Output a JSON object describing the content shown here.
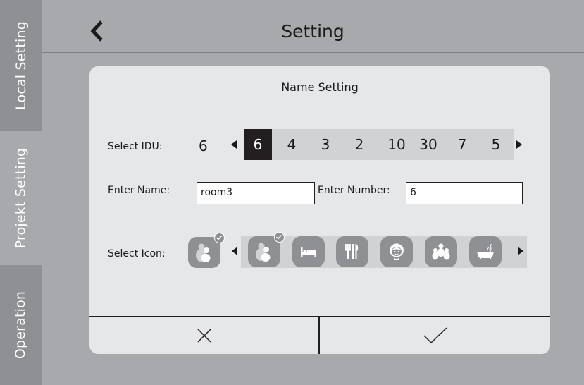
{
  "sidebar": {
    "tabs": [
      {
        "label": "Local Setting",
        "active": false
      },
      {
        "label": "Projekt Setting",
        "active": true
      },
      {
        "label": "Operation",
        "active": false
      }
    ]
  },
  "header": {
    "title": "Setting",
    "back_icon": "chevron-left-icon"
  },
  "dialog": {
    "title": "Name Setting",
    "select_idu": {
      "label": "Select IDU:",
      "current": "6",
      "options": [
        "6",
        "4",
        "3",
        "2",
        "10",
        "30",
        "7",
        "5"
      ],
      "selected_index": 0
    },
    "enter_name": {
      "label": "Enter Name:",
      "value": "room3"
    },
    "enter_number": {
      "label": "Enter Number:",
      "value": "6"
    },
    "select_icon": {
      "label": "Select Icon:",
      "current": "people-icon",
      "options": [
        "people-icon",
        "bed-icon",
        "dining-icon",
        "girl-face-icon",
        "family-icon",
        "bathtub-icon"
      ],
      "selected_index": 0
    },
    "cancel_icon": "close-icon",
    "confirm_icon": "checkmark-icon"
  },
  "colors": {
    "background": "#a7a9ac",
    "sidebar": "#8e9094",
    "card": "#e6e7e8",
    "strip": "#d1d2d4",
    "selected": "#231f20",
    "icon_tile": "#8e9094"
  }
}
